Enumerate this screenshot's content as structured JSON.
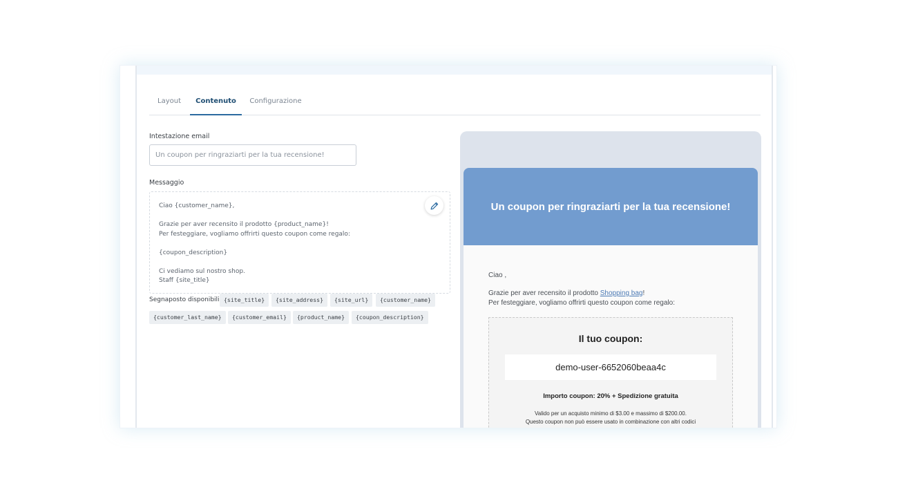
{
  "tabs": [
    {
      "label": "Layout"
    },
    {
      "label": "Contenuto"
    },
    {
      "label": "Configurazione"
    }
  ],
  "form": {
    "header_label": "Intestazione email",
    "header_placeholder": "Un coupon per ringraziarti per la tua recensione!",
    "message_label": "Messaggio",
    "message_lines": [
      "Ciao {customer_name},",
      "",
      "Grazie per aver recensito il prodotto {product_name}!",
      "Per festeggiare, vogliamo offrirti questo coupon come regalo:",
      "",
      "{coupon_description}",
      "",
      "Ci vediamo sul nostro shop.",
      "Staff {site_title}"
    ],
    "placeholders_label": "Segnaposto disponibili:",
    "placeholders": [
      "{site_title}",
      "{site_address}",
      "{site_url}",
      "{customer_name}",
      "{customer_last_name}",
      "{customer_email}",
      "{product_name}",
      "{coupon_description}"
    ]
  },
  "preview": {
    "title": "Un coupon per ringraziarti per la tua recensione!",
    "greeting": "Ciao ,",
    "line1_prefix": "Grazie per aver recensito il prodotto ",
    "line1_link": "Shopping bag",
    "line1_suffix": "!",
    "line2": "Per festeggiare, vogliamo offrirti questo coupon come regalo:",
    "coupon_heading": "Il tuo coupon:",
    "coupon_code": "demo-user-6652060beaa4c",
    "coupon_amount": "Importo coupon: 20% + Spedizione gratuita",
    "coupon_note1": "Valido per un acquisto minimo di $3.00 e massimo di $200.00.",
    "coupon_note2": "Questo coupon non può essere usato in combinazione con altri codici"
  },
  "colors": {
    "accent": "#2a6aa0",
    "mail_header": "#729ccf",
    "preview_bg": "#dde3ec"
  },
  "icons": {
    "edit": "pencil-icon"
  }
}
